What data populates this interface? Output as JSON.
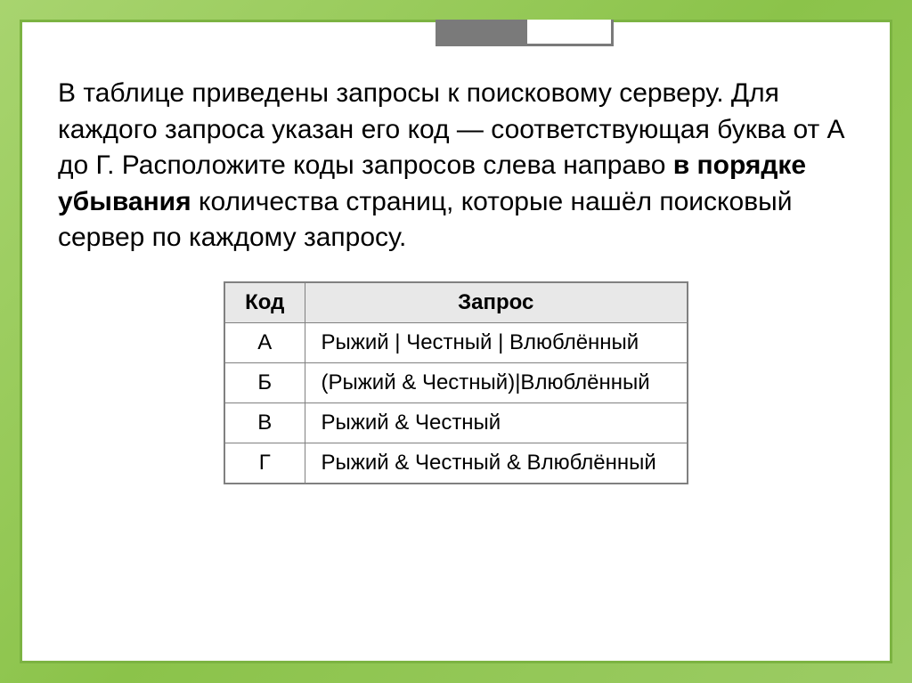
{
  "body": {
    "text_part1": "В таблице приведены запросы к поисковому серверу. Для каждого запроса указан его код — соответствующая буква от А до Г. Расположите коды запросов слева направо ",
    "text_bold": "в порядке убывания",
    "text_part2": " количества страниц, которые нашёл поисковый сервер по каждому запросу."
  },
  "table": {
    "headers": {
      "code": "Код",
      "query": "Запрос"
    },
    "rows": [
      {
        "code": "А",
        "query": "Рыжий | Честный | Влюблённый"
      },
      {
        "code": "Б",
        "query": "(Рыжий & Честный)|Влюблённый"
      },
      {
        "code": "В",
        "query": "Рыжий & Честный"
      },
      {
        "code": "Г",
        "query": "Рыжий & Честный & Влюблённый"
      }
    ]
  }
}
